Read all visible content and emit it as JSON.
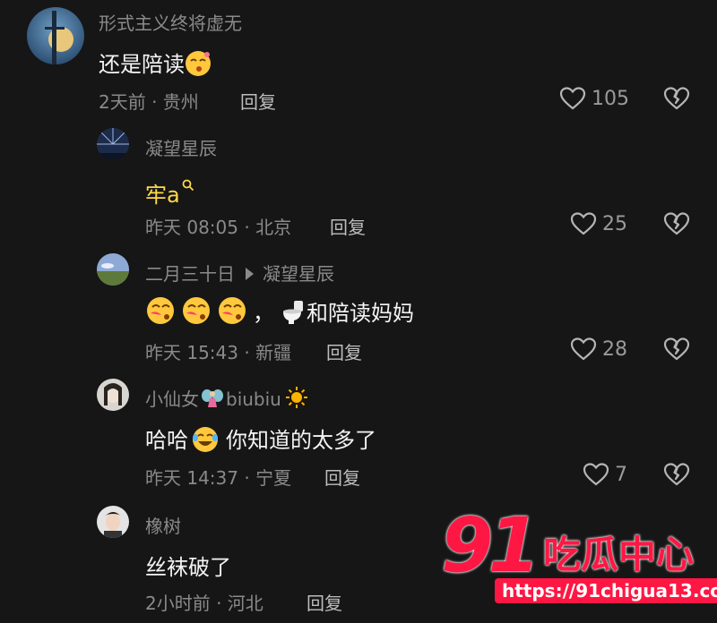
{
  "comments": [
    {
      "username": "形式主义终将虚无",
      "text": "还是陪读",
      "time": "2天前 · 贵州",
      "reply": "回复",
      "likes": "105"
    },
    {
      "username": "凝望星辰",
      "text": "牢a",
      "time": "昨天 08:05 · 北京",
      "reply": "回复",
      "likes": "25"
    },
    {
      "username": "二月三十日",
      "reply_to": "凝望星辰",
      "text_suffix": "和陪读妈妈",
      "text_comma": "，",
      "time": "昨天 15:43 · 新疆",
      "reply": "回复",
      "likes": "28"
    },
    {
      "username_main": "小仙女",
      "username_tail": "biubiu",
      "text_a": "哈哈",
      "text_b": "你知道的太多了",
      "time": "昨天 14:37 · 宁夏",
      "reply": "回复",
      "likes": "7"
    },
    {
      "username": "橡树",
      "text": "丝袜破了",
      "time": "2小时前 · 河北",
      "reply": "回复"
    }
  ],
  "watermark": {
    "logo": "91",
    "name": "吃瓜中心",
    "url": "https://91chigua13.com"
  },
  "icons": {
    "like": "heart-outline-icon",
    "dislike": "broken-heart-icon",
    "search": "search-icon"
  }
}
